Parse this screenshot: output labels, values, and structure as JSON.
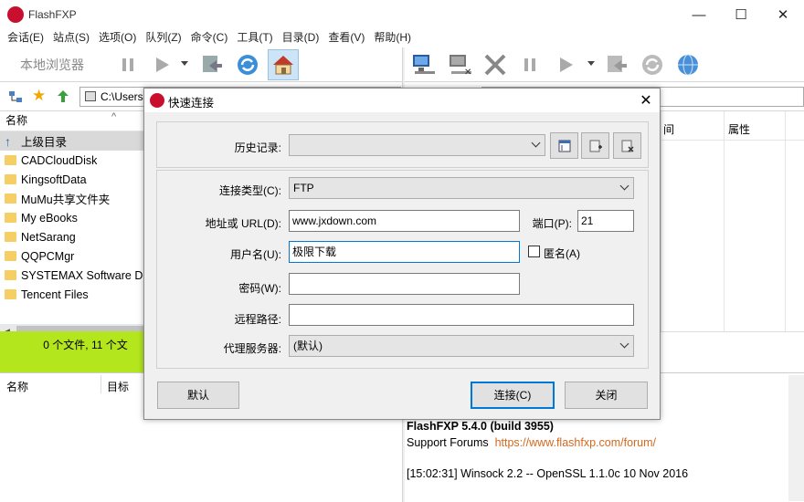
{
  "app": {
    "title": "FlashFXP"
  },
  "menu": [
    "会话(E)",
    "站点(S)",
    "选项(O)",
    "队列(Z)",
    "命令(C)",
    "工具(T)",
    "目录(D)",
    "查看(V)",
    "帮助(H)"
  ],
  "toolbar": {
    "local_browser_label": "本地浏览器"
  },
  "left_path": "C:\\Users",
  "left_pane": {
    "col_name": "名称",
    "items": [
      "上级目录",
      "CADCloudDisk",
      "KingsoftData",
      "MuMu共享文件夹",
      "My eBooks",
      "NetSarang",
      "QQPCMgr",
      "SYSTEMAX Software De",
      "Tencent Files"
    ],
    "status": "0 个文件, 11 个文"
  },
  "right_pane": {
    "col_time": "间",
    "col_attr": "属性"
  },
  "queue": {
    "col_name": "名称",
    "col_target": "目标"
  },
  "log": {
    "line1": "FlashFXP 5.4.0 (build 3955)",
    "line2_label": "Support Forums",
    "line2_link": "https://www.flashfxp.com/forum/",
    "line3": "[15:02:31] Winsock 2.2 -- OpenSSL 1.1.0c  10 Nov 2016"
  },
  "dialog": {
    "title": "快速连接",
    "history_label": "历史记录:",
    "history_value": "",
    "conn_type_label": "连接类型(C):",
    "conn_type_value": "FTP",
    "address_label": "地址或 URL(D):",
    "address_value": "www.jxdown.com",
    "port_label": "端口(P):",
    "port_value": "21",
    "user_label": "用户名(U):",
    "user_value": "极限下载",
    "anon_label": "匿名(A)",
    "password_label": "密码(W):",
    "password_value": "",
    "remote_path_label": "远程路径:",
    "remote_path_value": "",
    "proxy_label": "代理服务器:",
    "proxy_value": "(默认)",
    "default_button": "默认",
    "connect_button": "连接(C)",
    "close_button": "关闭"
  },
  "colors": {
    "status_green": "#b4e61e",
    "brand_red": "#c8102e",
    "link": "#d2691e"
  }
}
